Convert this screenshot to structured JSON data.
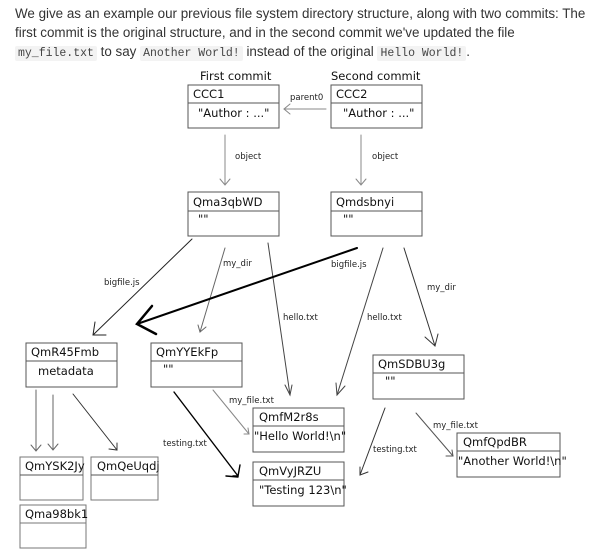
{
  "intro": {
    "part1": "We give as an example our previous file system directory structure, along with two commits: The first commit is the original structure, and in the second commit we've updated the file ",
    "code1": "my_file.txt",
    "part2": " to say ",
    "code2": "Another World!",
    "part3": " instead of the original ",
    "code3": "Hello World!",
    "part4": "."
  },
  "diagram": {
    "headers": {
      "first_commit": "First commit",
      "second_commit": "Second commit"
    },
    "nodes": {
      "ccc1": {
        "title": "CCC1",
        "body": "\"Author : ...\""
      },
      "ccc2": {
        "title": "CCC2",
        "body": "\"Author : ...\""
      },
      "qma3qbwd": {
        "title": "Qma3qbWD",
        "body": "\"\""
      },
      "qmdsbnyi": {
        "title": "Qmdsbnyi",
        "body": "\"\""
      },
      "qmr45fmb": {
        "title": "QmR45Fmb",
        "body": "metadata"
      },
      "qmyyekfp": {
        "title": "QmYYEkFp",
        "body": "\"\""
      },
      "qmsdbu3g": {
        "title": "QmSDBU3g",
        "body": "\"\""
      },
      "qmfm2r8s": {
        "title": "QmfM2r8s",
        "body": "\"Hello World!\\n\""
      },
      "qmvyjrzu": {
        "title": "QmVyJRZU",
        "body": "\"Testing 123\\n\""
      },
      "qmfqpdbr": {
        "title": "QmfQpdBR",
        "body": "\"Another World!\\n\""
      },
      "qmysk2jy": {
        "title": "QmYSK2Jy",
        "body": ""
      },
      "qmqeuqdj": {
        "title": "QmQeUqdj",
        "body": ""
      },
      "qma98bk1": {
        "title": "Qma98bk1",
        "body": ""
      }
    },
    "edge_labels": {
      "parent0": "parent0",
      "object1": "object",
      "object2": "object",
      "bigfile1": "bigfile.js",
      "mydir1": "my_dir",
      "hello1": "hello.txt",
      "bigfile2": "bigfile.js",
      "hello2": "hello.txt",
      "mydir2": "my_dir",
      "myfile1": "my_file.txt",
      "testing1": "testing.txt",
      "testing2": "testing.txt",
      "myfile2": "my_file.txt"
    }
  }
}
